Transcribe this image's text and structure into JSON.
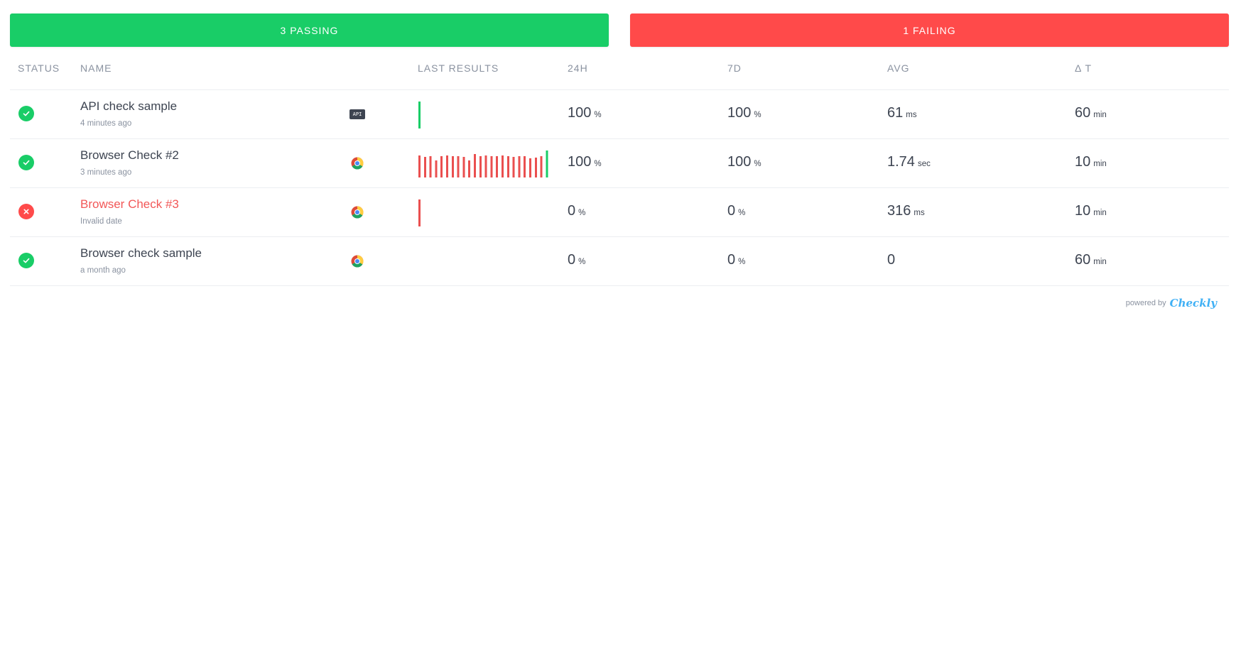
{
  "summary": {
    "passing_label": "3 PASSING",
    "failing_label": "1 FAILING",
    "passing_color": "#19cd67",
    "failing_color": "#ff4a4a"
  },
  "table": {
    "headers": {
      "status": "STATUS",
      "name": "NAME",
      "last_results": "LAST RESULTS",
      "h24": "24H",
      "d7": "7D",
      "avg": "AVG",
      "delta_t": "Δ T"
    },
    "rows": [
      {
        "status": "pass",
        "name": "API check sample",
        "time": "4 minutes ago",
        "type": "api",
        "type_label": "API",
        "last_results": [
          "pass"
        ],
        "h24_value": "100",
        "h24_unit": "%",
        "d7_value": "100",
        "d7_unit": "%",
        "avg_value": "61",
        "avg_unit": "ms",
        "dt_value": "60",
        "dt_unit": "min"
      },
      {
        "status": "pass",
        "name": "Browser Check #2",
        "time": "3 minutes ago",
        "type": "browser",
        "type_label": "",
        "last_results": [
          "fail",
          "fail",
          "fail",
          "fail",
          "fail",
          "fail",
          "fail",
          "fail",
          "fail",
          "fail",
          "fail",
          "fail",
          "fail",
          "fail",
          "fail",
          "fail",
          "fail",
          "fail",
          "fail",
          "fail",
          "fail",
          "fail",
          "fail",
          "pass"
        ],
        "h24_value": "100",
        "h24_unit": "%",
        "d7_value": "100",
        "d7_unit": "%",
        "avg_value": "1.74",
        "avg_unit": "sec",
        "dt_value": "10",
        "dt_unit": "min"
      },
      {
        "status": "fail",
        "name": "Browser Check #3",
        "time": "Invalid date",
        "type": "browser",
        "type_label": "",
        "last_results": [
          "fail"
        ],
        "h24_value": "0",
        "h24_unit": "%",
        "d7_value": "0",
        "d7_unit": "%",
        "avg_value": "316",
        "avg_unit": "ms",
        "dt_value": "10",
        "dt_unit": "min"
      },
      {
        "status": "pass",
        "name": "Browser check sample",
        "time": "a month ago",
        "type": "browser",
        "type_label": "",
        "last_results": [],
        "h24_value": "0",
        "h24_unit": "%",
        "d7_value": "0",
        "d7_unit": "%",
        "avg_value": "0",
        "avg_unit": "",
        "dt_value": "60",
        "dt_unit": "min"
      }
    ]
  },
  "footer": {
    "powered_by": "powered by",
    "brand": "Checkly",
    "brand_color": "#3fb0f5"
  },
  "icons": {
    "pass": "check-circle-icon",
    "fail": "x-circle-icon",
    "browser": "chrome-icon",
    "api": "api-badge-icon"
  }
}
